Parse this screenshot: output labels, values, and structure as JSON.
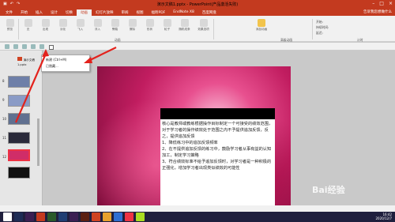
{
  "window": {
    "title": "演示文稿1.pptx - PowerPoint(产品激活失败)",
    "qat_icons": [
      "save-icon",
      "undo-icon",
      "redo-icon"
    ],
    "controls": [
      "–",
      "□",
      "×"
    ]
  },
  "tabs": [
    "文件",
    "开始",
    "插入",
    "设计",
    "切换",
    "动画",
    "幻灯片放映",
    "审阅",
    "视图",
    "福昕PDF",
    "EndNote X8",
    "百度网盘"
  ],
  "active_tab": "动画",
  "share": "告诉我您想做什么",
  "ribbon": {
    "preview": "预览",
    "effects": [
      "无",
      "出现",
      "淡化",
      "飞入",
      "浮入",
      "劈裂",
      "擦除",
      "形状",
      "轮子",
      "随机线条"
    ],
    "group_animation": "动画",
    "effect_options": "效果选项",
    "add_animation": "添加动画",
    "group_advanced": "高级动画",
    "group_timing": "计时",
    "timing_lines": [
      "开始:",
      "持续时间:",
      "延迟:"
    ]
  },
  "menu": {
    "item1": "新建 (Ctrl+M)",
    "item2": "已隐藏..."
  },
  "file_row": "演示文稿1.pptx",
  "slides": [
    {
      "num": "8"
    },
    {
      "num": "9"
    },
    {
      "num": "10"
    },
    {
      "num": "11"
    },
    {
      "num": "12"
    }
  ],
  "slide_text": [
    "核心是教师或教练根据操作目标制定一个可接受的绩效范围，对于学习者的操作绩效处于范围之内不予提供追加反馈，反之，提供追加反馈",
    "1、降低练习中的追加反馈频率",
    "2、在不提供追加反馈的练习中，鼓励学习者从事有益的认知加工，制定学习策略",
    "3、符合绩效标准不给予追加反馈时，对学习者是一种积极的正强化，增加学习者出现类似绩效的可能性"
  ],
  "clock": {
    "time": "16:42",
    "date": "2020/12/7"
  },
  "watermark": "Bai经验"
}
